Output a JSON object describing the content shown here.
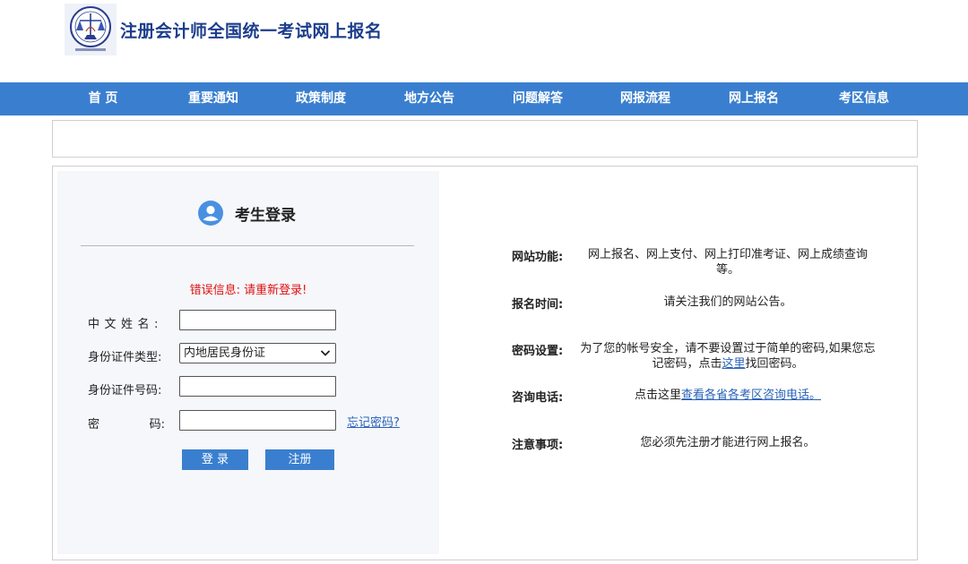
{
  "header": {
    "logo_icon": "cpa-seal-logo",
    "title": "注册会计师全国统一考试网上报名"
  },
  "nav": {
    "items": [
      {
        "label": "首 页"
      },
      {
        "label": "重要通知"
      },
      {
        "label": "政策制度"
      },
      {
        "label": "地方公告"
      },
      {
        "label": "问题解答"
      },
      {
        "label": "网报流程"
      },
      {
        "label": "网上报名"
      },
      {
        "label": "考区信息"
      }
    ]
  },
  "login": {
    "icon": "user-icon",
    "title": "考生登录",
    "error": "错误信息: 请重新登录!",
    "fields": {
      "name_label": "中文姓名:",
      "name_value": "",
      "id_type_label": "身份证件类型:",
      "id_type_selected": "内地居民身份证",
      "id_number_label": "身份证件号码:",
      "id_number_value": "",
      "password_label_1": "密",
      "password_label_2": "码:",
      "password_value": ""
    },
    "forgot_password": "忘记密码?",
    "login_button": "登 录",
    "register_button": "注册"
  },
  "info": {
    "function_label": "网站功能:",
    "function_text": "网上报名、网上支付、网上打印准考证、网上成绩查询等。",
    "time_label": "报名时间:",
    "time_text": "请关注我们的网站公告。",
    "password_label": "密码设置:",
    "password_text_1": "为了您的帐号安全，请不要设置过于简单的密码,如果您忘记密码，点击",
    "password_link": "这里",
    "password_text_2": "找回密码。",
    "phone_label": "咨询电话:",
    "phone_text": "点击这里",
    "phone_link": "查看各省各考区咨询电话。",
    "notes_label": "注意事项:",
    "notes_text": "您必须先注册才能进行网上报名。"
  },
  "colors": {
    "nav_blue": "#3a7fcf",
    "title_blue": "#1c3d8c",
    "error_red": "#e01010",
    "link_blue": "#2a62b8"
  }
}
